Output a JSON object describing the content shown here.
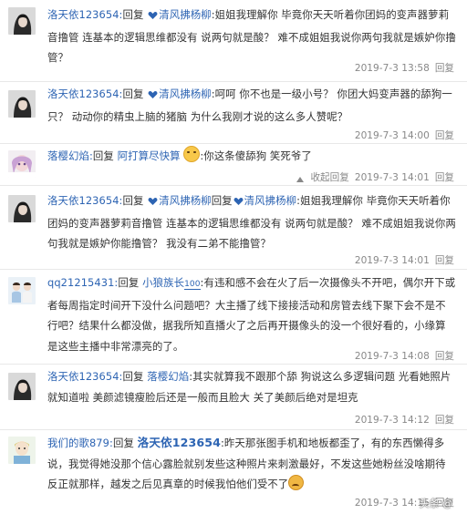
{
  "colors": {
    "link": "#2d64b3",
    "meta": "#888888",
    "divider": "#e8e8e8"
  },
  "comments": [
    {
      "user": "洛天依123654:",
      "reply_word": "回复",
      "target": "清风拂杨柳",
      "text": ":姐姐我理解你 毕竟你天天听着你团妈的变声器萝莉音撸管 连基本的逻辑思维都没有 说两句就是酸？ 难不成姐姐我说你两句我就是嫉妒你撸管？",
      "date": "2019-7-3 13:58",
      "action": "回复"
    },
    {
      "user": "洛天依123654:",
      "reply_word": "回复",
      "target": "清风拂杨柳",
      "text": ":呵呵 你不也是一级小号？ 你团大妈变声器的舔狗一只？ 动动你的精虫上脑的猪脑 为什么我刚才说的这么多人赞呢？",
      "date": "2019-7-3 14:00",
      "action": "回复"
    },
    {
      "user": "落樱幻焰:",
      "reply_word": "回复",
      "target": "阿打算尽快算",
      "text": ":你这条傻舔狗 笑死爷了",
      "date": "2019-7-3 14:01",
      "action": "回复",
      "collapse": "收起回复"
    },
    {
      "user": "洛天依123654:",
      "reply_word": "回复",
      "target": "清风拂杨柳",
      "nested_target": "清风拂杨柳",
      "text": ":姐姐我理解你 毕竟你天天听着你团妈的变声器萝莉音撸管 连基本的逻辑思维都没有 说两句就是酸？ 难不成姐姐我说你两句我就是嫉妒你能撸管？ 我没有二弟不能撸管？",
      "date": "2019-7-3 14:01",
      "action": "回复"
    },
    {
      "user": "qq21215431:",
      "reply_word": "回复",
      "target": "小狼族长",
      "target_badge": "100",
      "text": ":有违和感不会在火了后一次摄像头不开吧，偶尔开下或者每周指定时间开下没什么问题吧？大主播了线下接接活动和房管去线下聚下会不是不行吧？结果什么都没做，据我所知直播火了之后再开摄像头的没一个很好看的，小缘算是这些主播中非常漂亮的了。",
      "date": "2019-7-3 14:08",
      "action": "回复"
    },
    {
      "user": "洛天依123654:",
      "reply_word": "回复",
      "target": "落樱幻焰",
      "text": ":其实就算我不跟那个舔 狗说这么多逻辑问题 光看她照片就知道啦 美颜滤镜瘦脸后还是一般而且脸大 关了美颜后绝对是坦克",
      "date": "2019-7-3 14:12",
      "action": "回复"
    },
    {
      "user": "我们的歌879:",
      "reply_word": "回复",
      "target": "洛天依123654",
      "text": ":昨天那张图手机和地板都歪了，有的东西懒得多说，我觉得她没那个信心露脸就别发些这种照片来刺激最好，不发这些她粉丝没啥期待反正就那样，越发之后见真章的时候我怕他们受不了",
      "date": "2019-7-3 14:15",
      "action": "回复"
    }
  ],
  "watermark": "头条 @"
}
